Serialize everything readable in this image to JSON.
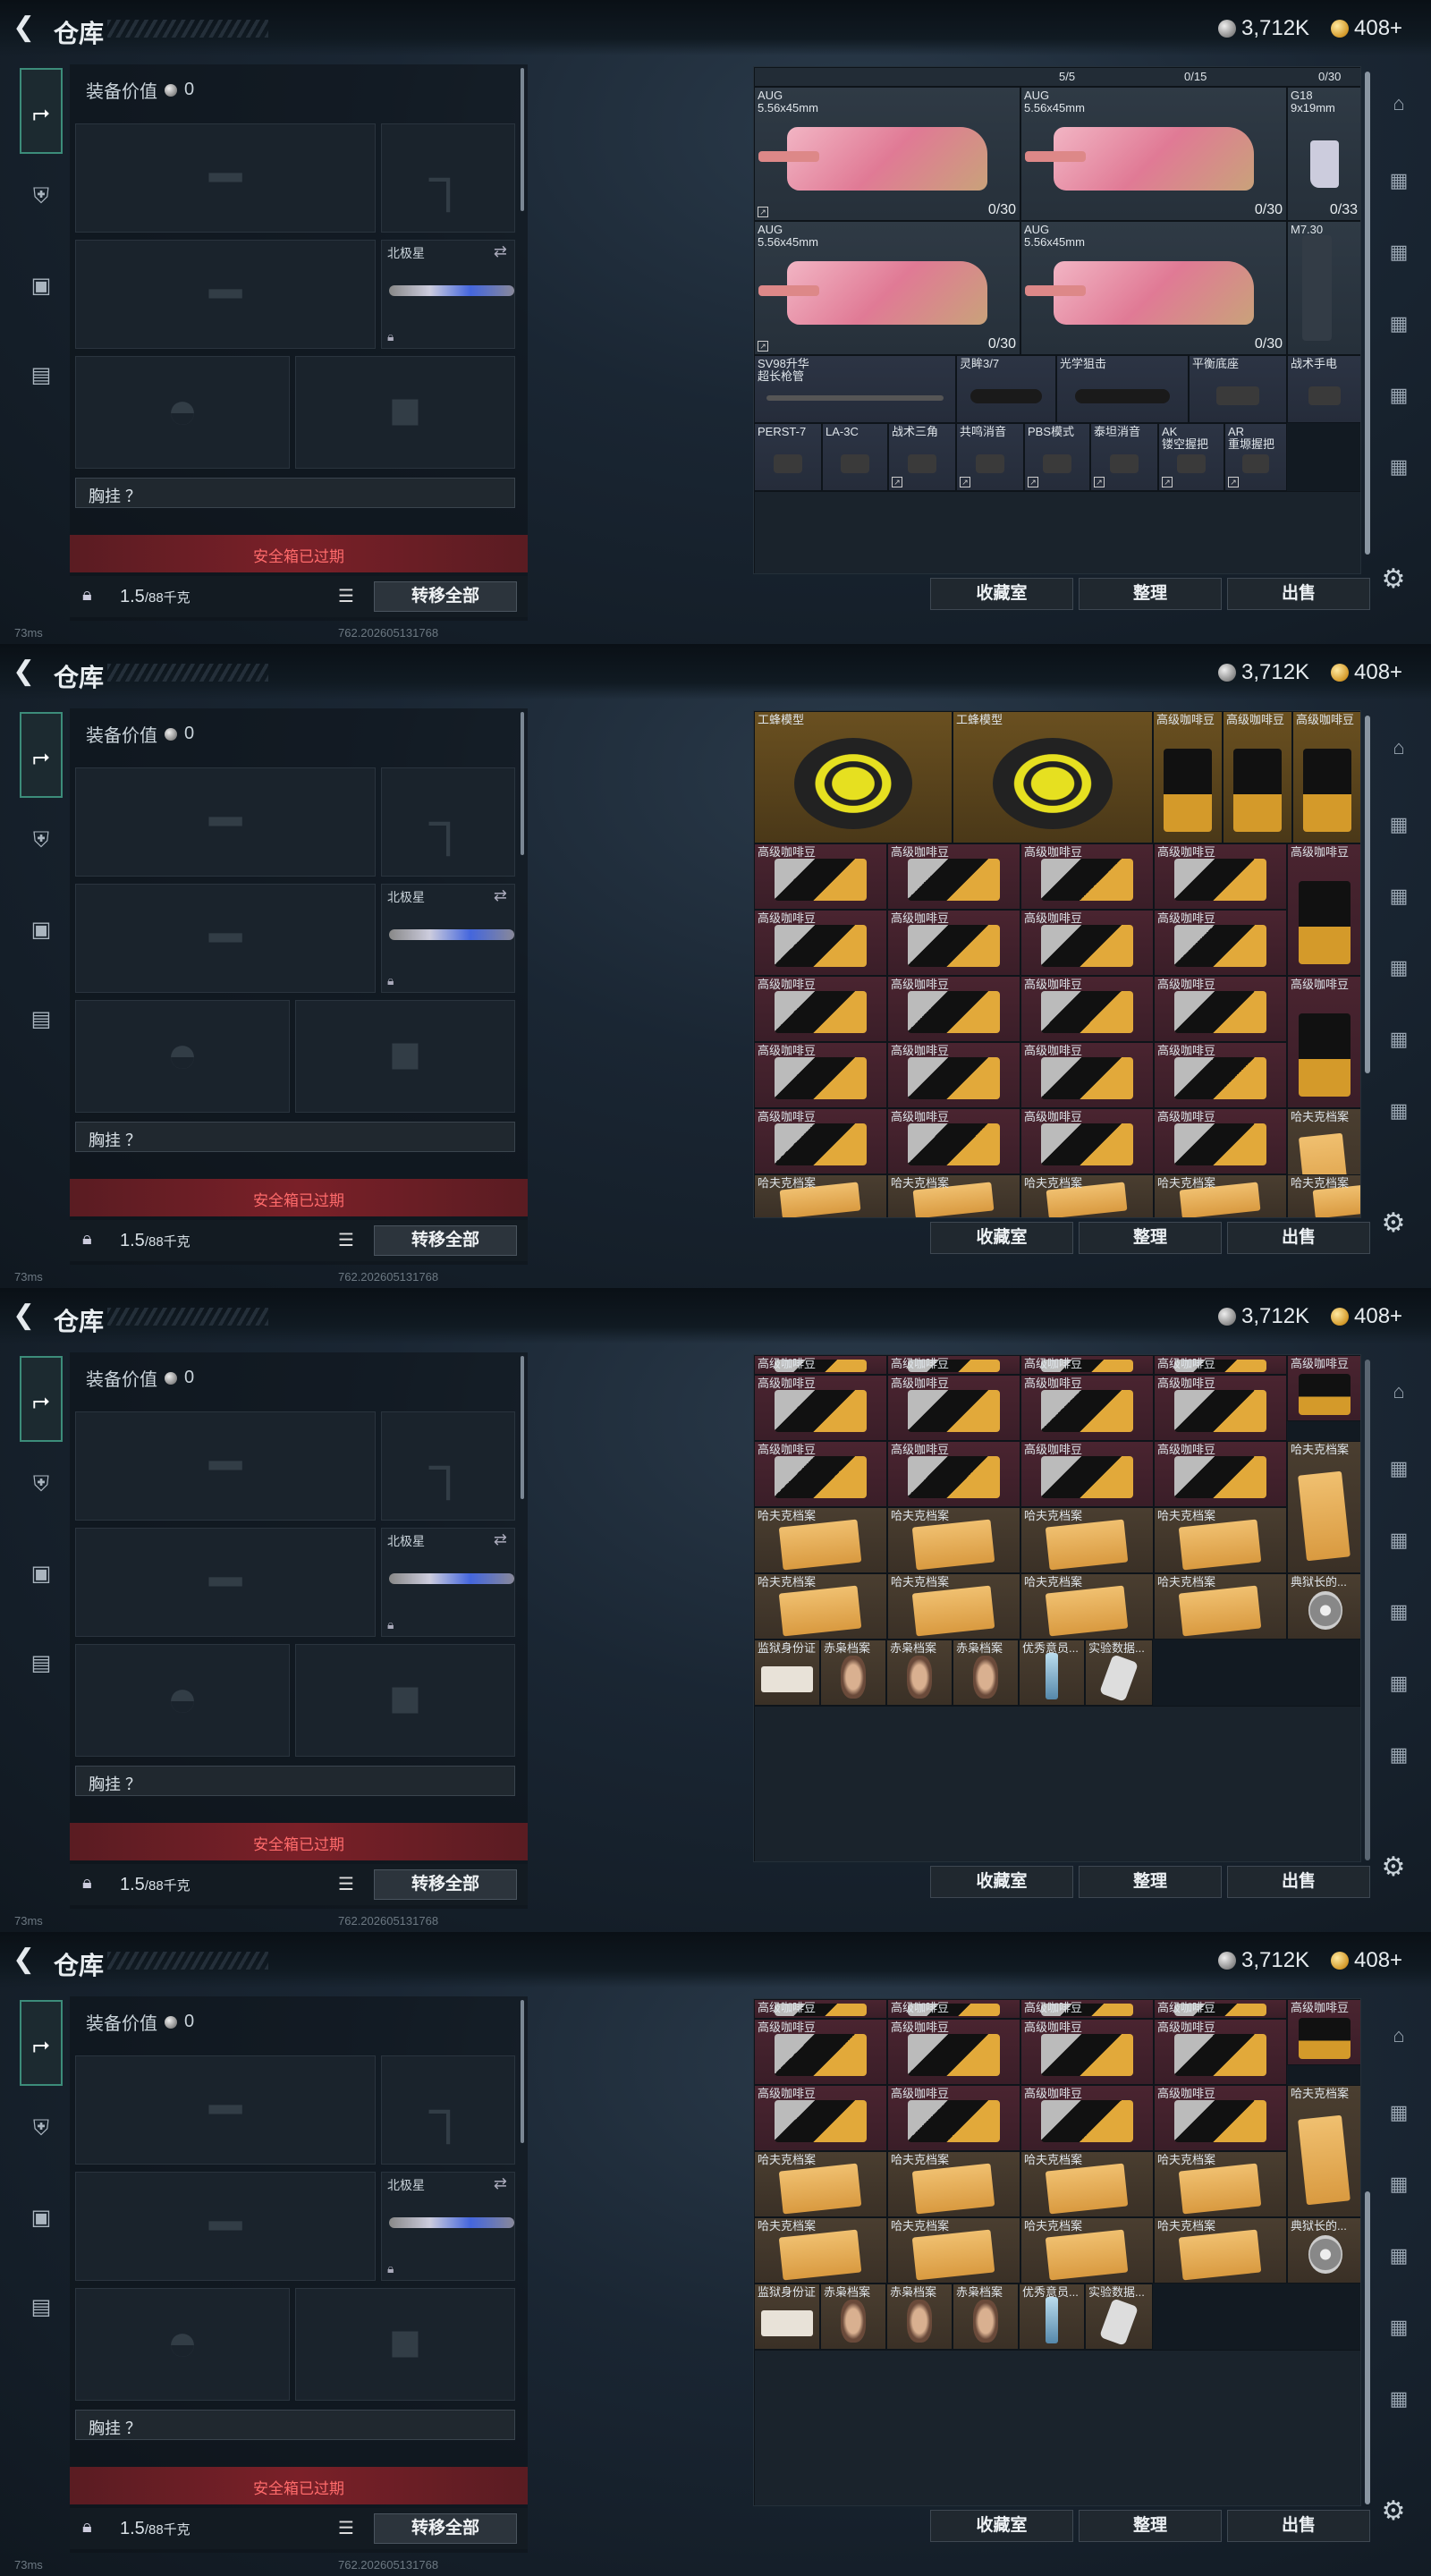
{
  "title": "仓库",
  "currency": {
    "silver": "3,712K",
    "gold": "408+"
  },
  "equipment": {
    "value_label": "装备价值",
    "value": "0",
    "knife_label": "北极星",
    "chest_label": "胸挂 ？",
    "safe_box_status": "安全箱已过期",
    "weight": "1.5",
    "weight_max": "/88千克",
    "transfer_all": "转移全部"
  },
  "footer": {
    "ping": "73ms",
    "build": "762.202605131768"
  },
  "buttons": {
    "collection": "收藏室",
    "organize": "整理",
    "sell": "出售"
  },
  "panel1": {
    "header_counts": [
      "5/5",
      "0/15",
      "0/30"
    ],
    "guns": [
      {
        "name": "AUG\n5.56x45mm",
        "count": "0/30"
      },
      {
        "name": "AUG\n5.56x45mm",
        "count": "0/30"
      },
      {
        "name": "G18\n9x19mm",
        "count": "0/33"
      },
      {
        "name": "AUG\n5.56x45mm",
        "count": "0/30"
      },
      {
        "name": "AUG\n5.56x45mm",
        "count": "0/30"
      },
      {
        "name": "M7.30",
        "count": ""
      }
    ],
    "attachments_row1": [
      "SV98升华\n超长枪管",
      "灵眸3/7",
      "光学狙击",
      "平衡底座",
      "战术手电"
    ],
    "attachments_row2": [
      "PERST-7",
      "LA-3C",
      "战术三角",
      "共鸣消音",
      "PBS模式",
      "泰坦消音",
      "AK\n镂空握把",
      "AR\n重塬握把"
    ]
  },
  "items": {
    "wasp": "工蜂模型",
    "coffee": "高级咖啡豆",
    "file": "哈夫克档案",
    "tape": "典狱长的...",
    "id": "监狱身份证",
    "falcon": "赤枭档案",
    "excellent": "优秀意员...",
    "data": "实验数据..."
  }
}
